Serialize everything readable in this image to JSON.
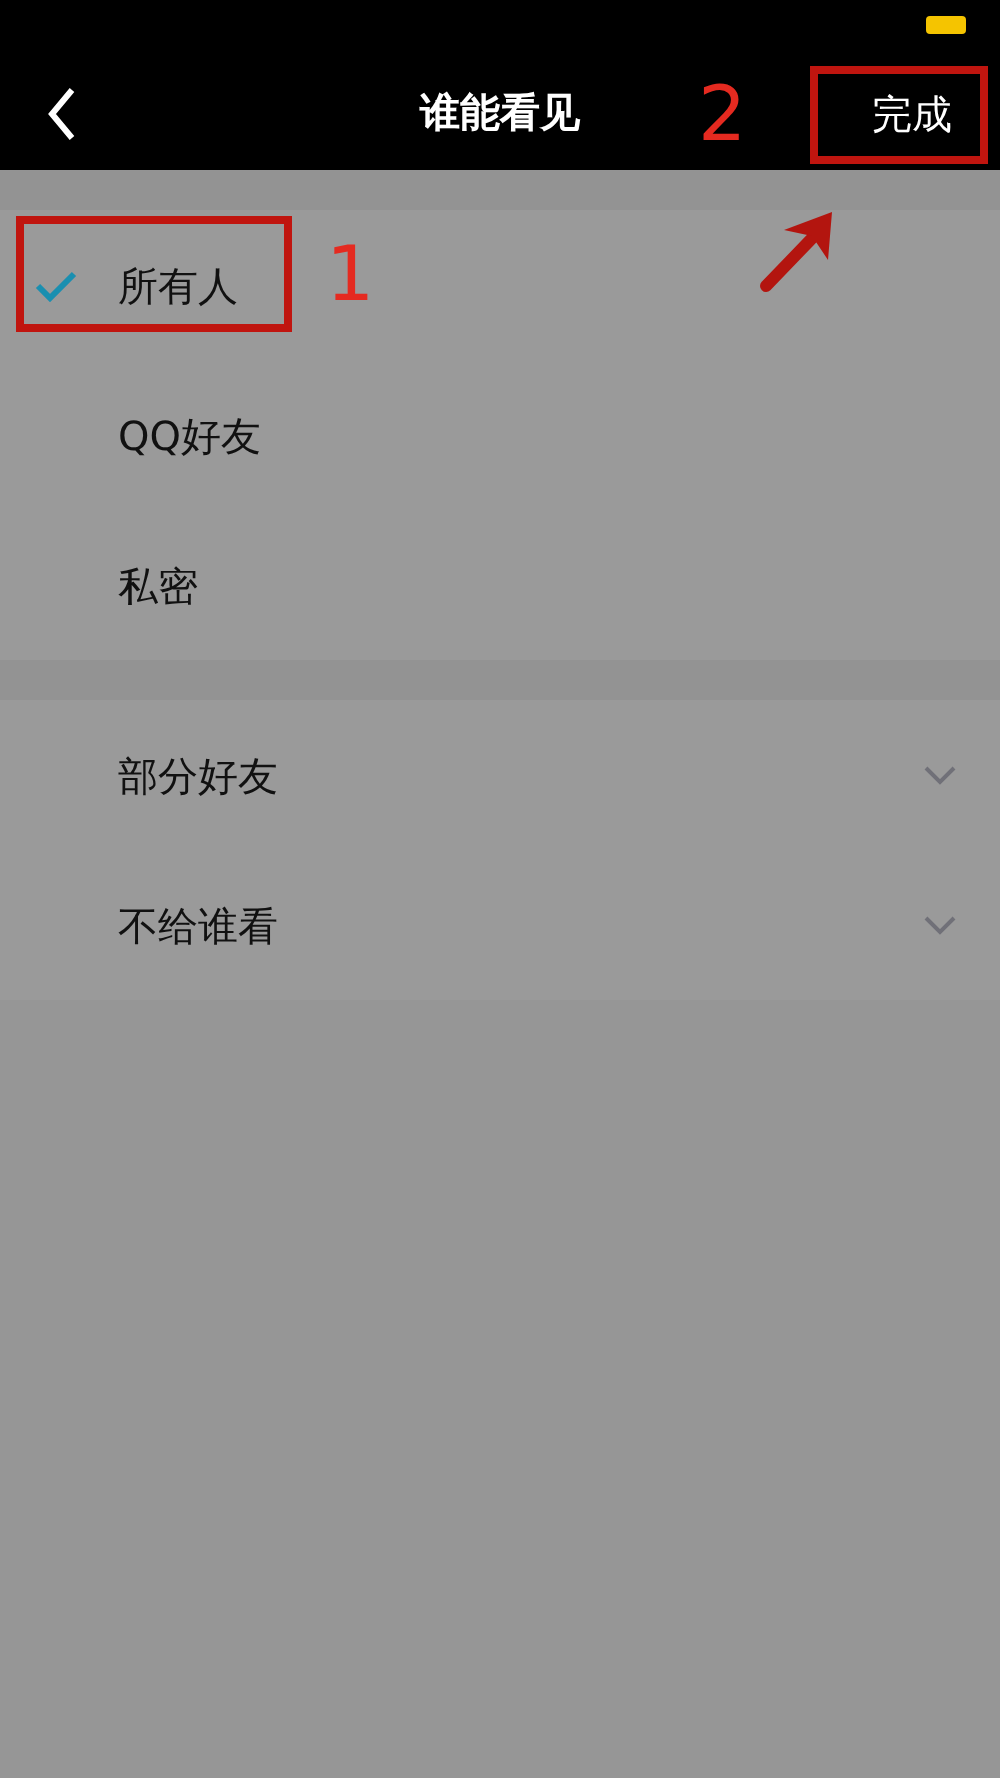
{
  "header": {
    "title": "谁能看见",
    "done": {
      "label": "完成",
      "highlighted": true,
      "annotation": "2",
      "pointer_arrow": true
    }
  },
  "sections": [
    {
      "items": [
        {
          "kind": "option",
          "label": "所有人",
          "selected": true,
          "highlighted": true,
          "annotation": "1"
        },
        {
          "kind": "option",
          "label": "QQ好友",
          "selected": false,
          "highlighted": false
        },
        {
          "kind": "option",
          "label": "私密",
          "selected": false,
          "highlighted": false
        }
      ]
    },
    {
      "items": [
        {
          "kind": "expand",
          "label": "部分好友",
          "expanded": false
        },
        {
          "kind": "expand",
          "label": "不给谁看",
          "expanded": false
        }
      ]
    }
  ]
}
